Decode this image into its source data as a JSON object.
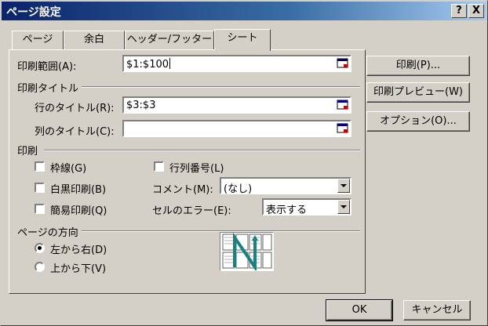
{
  "window": {
    "title": "ページ設定",
    "help_btn": "?",
    "close_btn": "X"
  },
  "tabs": [
    {
      "label": "ページ",
      "active": false
    },
    {
      "label": "余白",
      "active": false
    },
    {
      "label": "ヘッダー/フッター",
      "active": false
    },
    {
      "label": "シート",
      "active": true
    }
  ],
  "print_area": {
    "label": "印刷範囲(A):",
    "value": "$1:$100"
  },
  "print_titles": {
    "group_label": "印刷タイトル",
    "rows_label": "行のタイトル(R):",
    "rows_value": "$3:$3",
    "cols_label": "列のタイトル(C):",
    "cols_value": ""
  },
  "print": {
    "group_label": "印刷",
    "gridlines": "枠線(G)",
    "black_white": "白黒印刷(B)",
    "draft": "簡易印刷(Q)",
    "row_col_headings": "行列番号(L)",
    "comments_label": "コメント(M):",
    "comments_value": "(なし)",
    "errors_label": "セルのエラー(E):",
    "errors_value": "表示する"
  },
  "page_order": {
    "group_label": "ページの方向",
    "down_then_over": "左から右(D)",
    "over_then_down": "上から下(V)"
  },
  "buttons": {
    "print": "印刷(P)...",
    "preview": "印刷プレビュー(W)",
    "options": "オプション(O)...",
    "ok": "OK",
    "cancel": "キャンセル"
  }
}
